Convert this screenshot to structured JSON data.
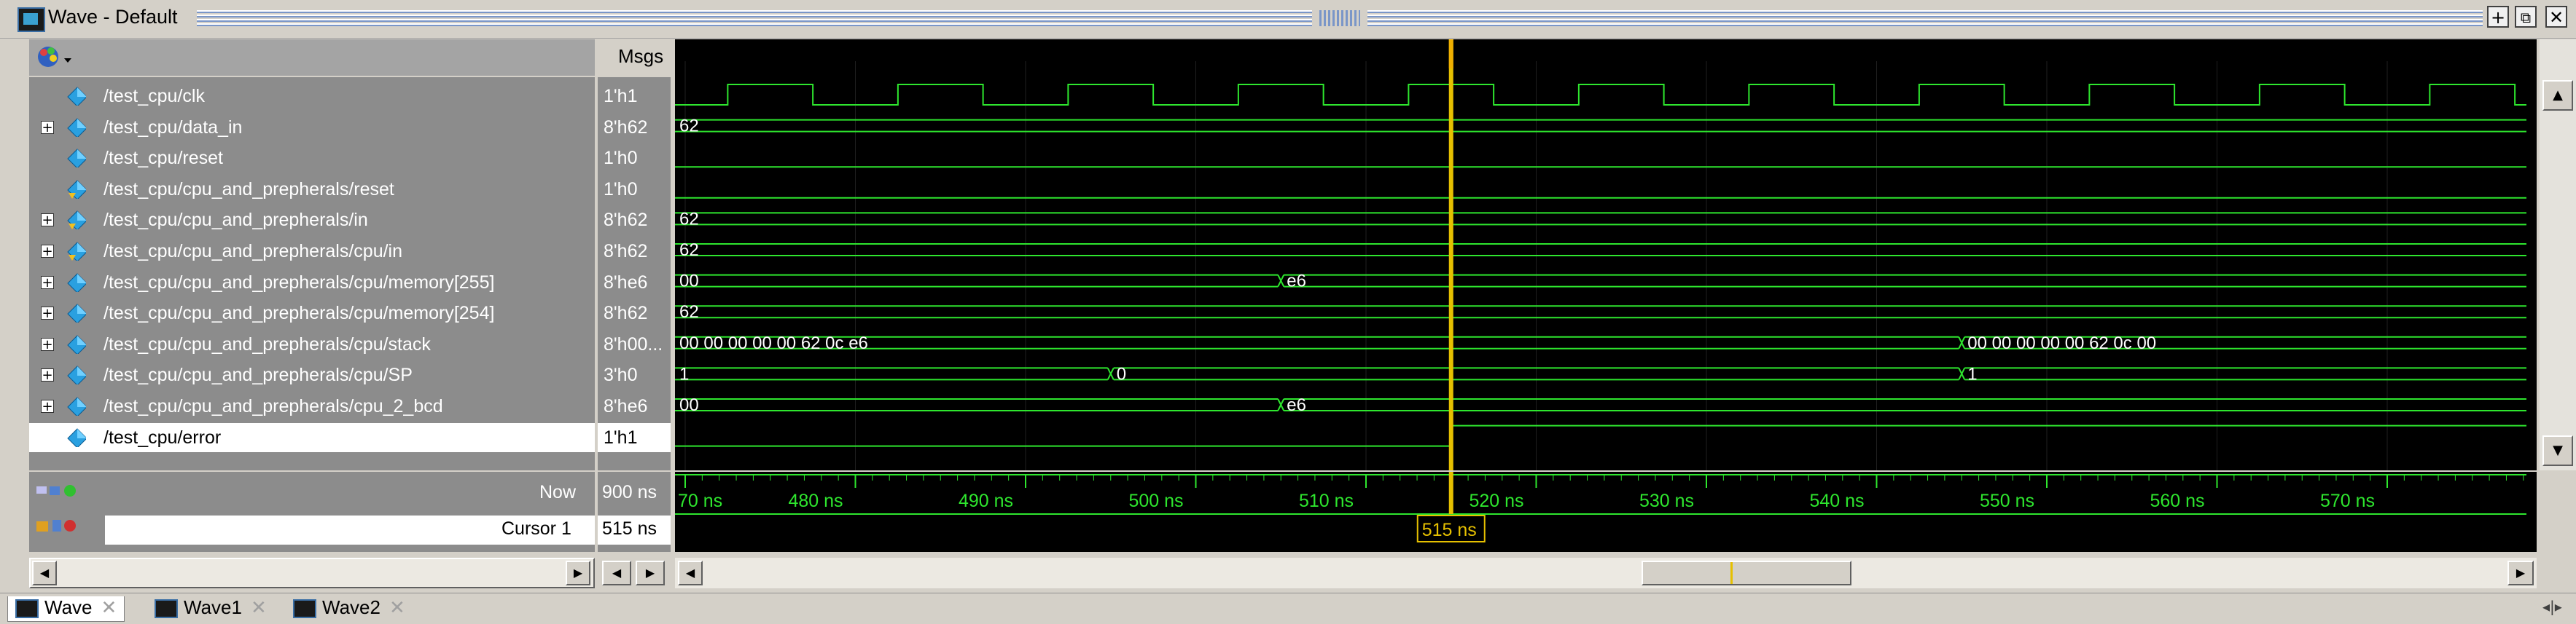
{
  "window": {
    "title": "Wave - Default",
    "buttons": {
      "dock": "+",
      "undock": "⧉",
      "close": "✕"
    }
  },
  "headers": {
    "msgs": "Msgs"
  },
  "signals": [
    {
      "name": "/test_cpu/clk",
      "value": "1'h1",
      "expandable": false,
      "icon": "diamond-icon"
    },
    {
      "name": "/test_cpu/data_in",
      "value": "8'h62",
      "expandable": true,
      "icon": "diamond-icon"
    },
    {
      "name": "/test_cpu/reset",
      "value": "1'h0",
      "expandable": false,
      "icon": "diamond-icon"
    },
    {
      "name": "/test_cpu/cpu_and_prepherals/reset",
      "value": "1'h0",
      "expandable": false,
      "icon": "diamond-input-icon"
    },
    {
      "name": "/test_cpu/cpu_and_prepherals/in",
      "value": "8'h62",
      "expandable": true,
      "icon": "diamond-input-icon"
    },
    {
      "name": "/test_cpu/cpu_and_prepherals/cpu/in",
      "value": "8'h62",
      "expandable": true,
      "icon": "diamond-input-icon"
    },
    {
      "name": "/test_cpu/cpu_and_prepherals/cpu/memory[255]",
      "value": "8'he6",
      "expandable": true,
      "icon": "diamond-icon"
    },
    {
      "name": "/test_cpu/cpu_and_prepherals/cpu/memory[254]",
      "value": "8'h62",
      "expandable": true,
      "icon": "diamond-icon"
    },
    {
      "name": "/test_cpu/cpu_and_prepherals/cpu/stack",
      "value": "8'h00...",
      "expandable": true,
      "icon": "diamond-icon"
    },
    {
      "name": "/test_cpu/cpu_and_prepherals/cpu/SP",
      "value": "3'h0",
      "expandable": true,
      "icon": "diamond-icon"
    },
    {
      "name": "/test_cpu/cpu_and_prepherals/cpu_2_bcd",
      "value": "8'he6",
      "expandable": true,
      "icon": "diamond-icon"
    },
    {
      "name": "/test_cpu/error",
      "value": "1'h1",
      "expandable": false,
      "icon": "diamond-icon",
      "selected": true
    }
  ],
  "bus_labels": {
    "data_in": [
      "62"
    ],
    "in": [
      "62"
    ],
    "cpu_in": [
      "62"
    ],
    "memory255": [
      "00",
      "e6"
    ],
    "memory254": [
      "62"
    ],
    "stack": [
      "00 00 00 00 00 62 0c e6",
      "00 00 00 00 00 62 0c 00"
    ],
    "sp": [
      "1",
      "0",
      "1"
    ],
    "cpu_2_bcd": [
      "00",
      "e6"
    ]
  },
  "time": {
    "now_label": "Now",
    "now_value": "900 ns",
    "cursor_label": "Cursor 1",
    "cursor_value": "515 ns",
    "cursor_tag": "515 ns",
    "ticks": [
      "70 ns",
      "480 ns",
      "490 ns",
      "500 ns",
      "510 ns",
      "520 ns",
      "530 ns",
      "540 ns",
      "550 ns",
      "560 ns",
      "570 ns"
    ]
  },
  "tabs": [
    "Wave",
    "Wave1",
    "Wave2"
  ],
  "colors": {
    "wave": "#2ee62e",
    "cursor": "#e6c000",
    "background": "#000000"
  }
}
